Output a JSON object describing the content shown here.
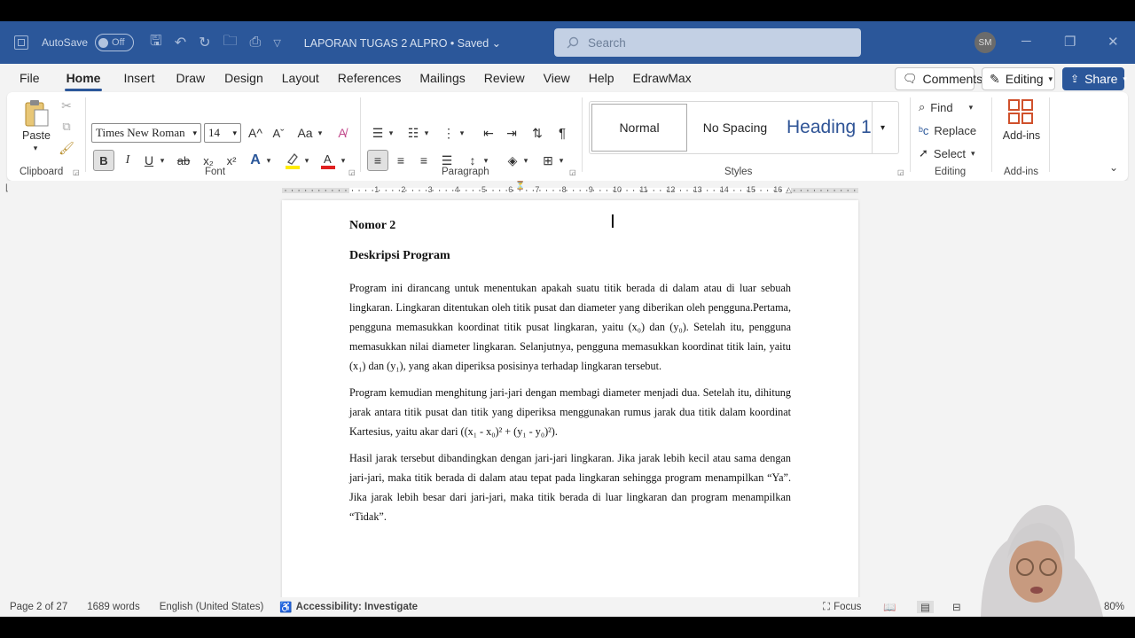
{
  "titlebar": {
    "autosave_label": "AutoSave",
    "autosave_state": "Off",
    "doc_title": "LAPORAN TUGAS 2 ALPRO • Saved ⌄",
    "search_placeholder": "Search",
    "avatar_initials": "SM"
  },
  "menu": {
    "tabs": [
      "File",
      "Home",
      "Insert",
      "Draw",
      "Design",
      "Layout",
      "References",
      "Mailings",
      "Review",
      "View",
      "Help",
      "EdrawMax"
    ],
    "active_tab": "Home",
    "comments_label": "Comments",
    "editing_label": "Editing",
    "share_label": "Share"
  },
  "ribbon": {
    "clipboard": {
      "label": "Clipboard",
      "paste_label": "Paste"
    },
    "font": {
      "label": "Font",
      "font_name": "Times New Roman",
      "font_size": "14",
      "grow": "A^",
      "shrink": "Aˇ",
      "case": "Aa",
      "bold": "B",
      "italic": "I",
      "underline": "U",
      "strike": "ab",
      "subscript": "x₂",
      "superscript": "x²"
    },
    "paragraph": {
      "label": "Paragraph"
    },
    "styles": {
      "label": "Styles",
      "items": [
        "Normal",
        "No Spacing",
        "Heading 1"
      ]
    },
    "editing": {
      "label": "Editing",
      "find": "Find",
      "replace": "Replace",
      "select": "Select"
    },
    "addins": {
      "label": "Add-ins",
      "button": "Add-ins"
    }
  },
  "ruler": {
    "marks": [
      "1",
      "2",
      "3",
      "4",
      "5",
      "6",
      "7",
      "8",
      "9",
      "10",
      "11",
      "12",
      "13",
      "14",
      "15",
      "16"
    ]
  },
  "document": {
    "heading1": "Nomor 2",
    "heading2": "Deskripsi Program",
    "para1": "Program ini dirancang untuk menentukan apakah suatu titik berada di dalam atau di luar sebuah lingkaran. Lingkaran ditentukan oleh titik pusat dan diameter yang diberikan oleh pengguna.Pertama, pengguna memasukkan koordinat titik pusat lingkaran, yaitu (x₀) dan (y₀). Setelah itu, pengguna memasukkan nilai diameter lingkaran. Selanjutnya, pengguna memasukkan koordinat titik lain, yaitu (x₁) dan (y₁), yang akan diperiksa posisinya terhadap lingkaran tersebut.",
    "para2": "Program kemudian menghitung jari-jari dengan membagi diameter menjadi dua. Setelah itu, dihitung jarak antara titik pusat dan titik yang diperiksa menggunakan rumus jarak dua titik dalam koordinat Kartesius, yaitu akar dari ((x₁ - x₀)² + (y₁ - y₀)²).",
    "para3": "Hasil jarak tersebut dibandingkan dengan jari-jari lingkaran. Jika jarak lebih kecil atau sama dengan jari-jari, maka titik berada di dalam atau tepat pada lingkaran sehingga program menampilkan “Ya”. Jika jarak lebih besar dari jari-jari, maka titik berada di luar lingkaran dan program menampilkan “Tidak”."
  },
  "status": {
    "page": "Page 2 of 27",
    "words": "1689 words",
    "language": "English (United States)",
    "accessibility": "Accessibility: Investigate",
    "focus": "Focus",
    "zoom": "80%"
  },
  "colors": {
    "titlebar": "#2b579a",
    "accent": "#2b579a",
    "font_color_bar": "#e02020",
    "highlight_bar": "#ffeb00"
  }
}
